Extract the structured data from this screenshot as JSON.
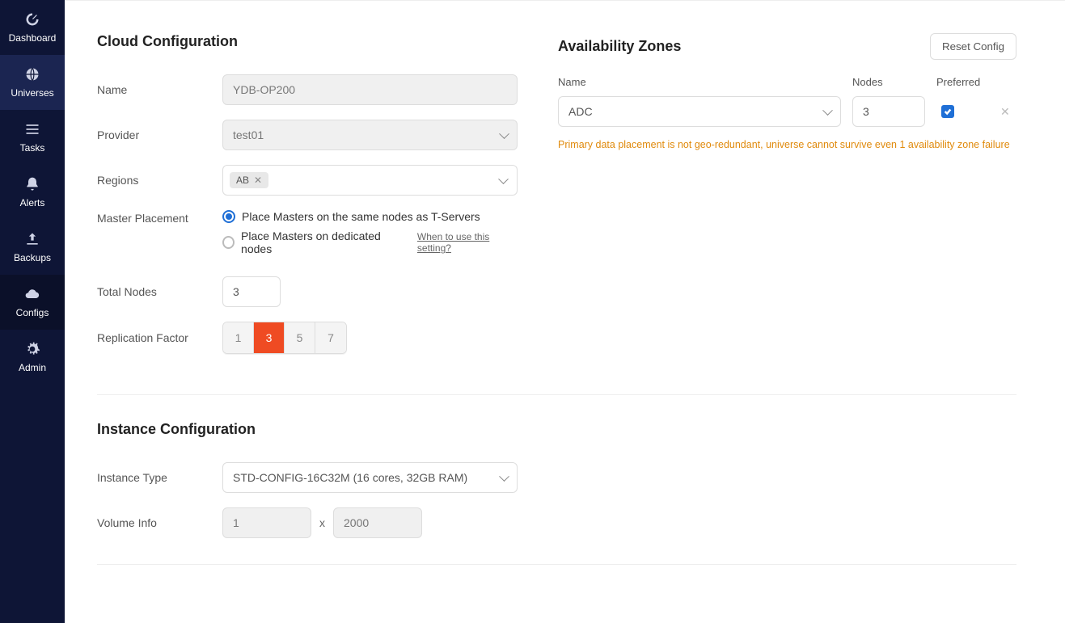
{
  "sidebar": {
    "items": [
      {
        "label": "Dashboard"
      },
      {
        "label": "Universes"
      },
      {
        "label": "Tasks"
      },
      {
        "label": "Alerts"
      },
      {
        "label": "Backups"
      },
      {
        "label": "Configs"
      },
      {
        "label": "Admin"
      }
    ]
  },
  "cloud": {
    "section_title": "Cloud Configuration",
    "labels": {
      "name": "Name",
      "provider": "Provider",
      "regions": "Regions",
      "master_placement": "Master Placement",
      "total_nodes": "Total Nodes",
      "replication_factor": "Replication Factor"
    },
    "name_value": "YDB-OP200",
    "provider_value": "test01",
    "region_chip": "AB",
    "master_placement": {
      "opt_same": "Place Masters on the same nodes as T-Servers",
      "opt_dedicated": "Place Masters on dedicated nodes",
      "help_link": "When to use this setting?"
    },
    "total_nodes_value": "3",
    "rf_options": [
      "1",
      "3",
      "5",
      "7"
    ]
  },
  "az": {
    "section_title": "Availability Zones",
    "reset_label": "Reset Config",
    "col_name": "Name",
    "col_nodes": "Nodes",
    "col_preferred": "Preferred",
    "row": {
      "name": "ADC",
      "nodes": "3"
    },
    "warning": "Primary data placement is not geo-redundant, universe cannot survive even 1 availability zone failure"
  },
  "instance": {
    "section_title": "Instance Configuration",
    "labels": {
      "instance_type": "Instance Type",
      "volume_info": "Volume Info"
    },
    "instance_type_value": "STD-CONFIG-16C32M (16 cores, 32GB RAM)",
    "volume_count": "1",
    "volume_x": "x",
    "volume_size": "2000"
  }
}
